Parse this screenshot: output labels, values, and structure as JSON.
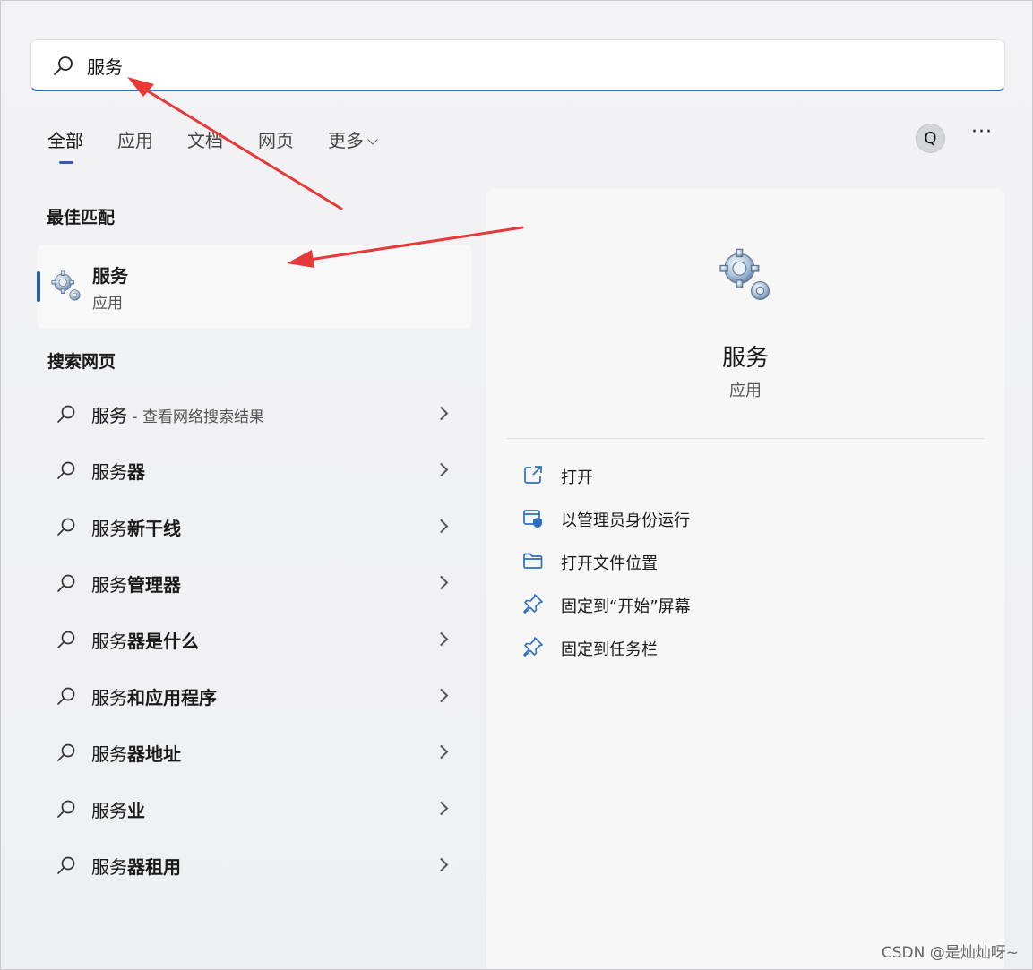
{
  "search": {
    "value": "服务"
  },
  "tabs": [
    {
      "label": "全部",
      "active": true
    },
    {
      "label": "应用"
    },
    {
      "label": "文档"
    },
    {
      "label": "网页"
    },
    {
      "label": "更多"
    }
  ],
  "toolbar": {
    "avatar_letter": "Q",
    "more_label": "···"
  },
  "best_match": {
    "section_title": "最佳匹配",
    "name": "服务",
    "type": "应用",
    "icon": "gear-icon"
  },
  "web_search": {
    "section_title": "搜索网页",
    "items": [
      {
        "plain": "服务",
        "bold": "",
        "hint": " - 查看网络搜索结果"
      },
      {
        "plain": "服务",
        "bold": "器",
        "hint": ""
      },
      {
        "plain": "服务",
        "bold": "新干线",
        "hint": ""
      },
      {
        "plain": "服务",
        "bold": "管理器",
        "hint": ""
      },
      {
        "plain": "服务",
        "bold": "器是什么",
        "hint": ""
      },
      {
        "plain": "服务",
        "bold": "和应用程序",
        "hint": ""
      },
      {
        "plain": "服务",
        "bold": "器地址",
        "hint": ""
      },
      {
        "plain": "服务",
        "bold": "业",
        "hint": ""
      },
      {
        "plain": "服务",
        "bold": "器租用",
        "hint": ""
      }
    ]
  },
  "detail": {
    "name": "服务",
    "type": "应用",
    "actions": [
      {
        "label": "打开",
        "icon": "open-external-icon"
      },
      {
        "label": "以管理员身份运行",
        "icon": "shield-admin-icon"
      },
      {
        "label": "打开文件位置",
        "icon": "folder-icon"
      },
      {
        "label": "固定到“开始”屏幕",
        "icon": "pin-icon"
      },
      {
        "label": "固定到任务栏",
        "icon": "pin-icon"
      }
    ]
  },
  "watermark": "CSDN @是灿灿呀~",
  "colors": {
    "accent": "#2c5fa7",
    "annotation": "#e8393a"
  }
}
